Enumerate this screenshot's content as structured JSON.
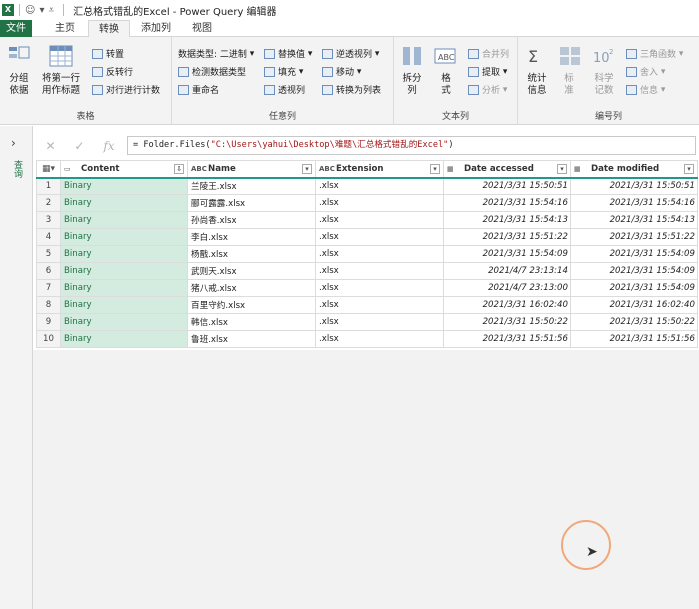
{
  "titlebar": {
    "app_icon": "X",
    "title": "汇总格式错乱的Excel - Power Query 编辑器"
  },
  "tabs": [
    {
      "label": "文件"
    },
    {
      "label": "主页"
    },
    {
      "label": "转换"
    },
    {
      "label": "添加列"
    },
    {
      "label": "视图"
    }
  ],
  "ribbon": {
    "table_group": {
      "label": "表格",
      "group_by": "分组\n依据",
      "first_row_header": "将第一行\n用作标题",
      "transpose": "转置",
      "reverse_rows": "反转行",
      "count_rows": "对行进行计数"
    },
    "any_column_group": {
      "label": "任意列",
      "data_type": "数据类型: 二进制",
      "detect_type": "检测数据类型",
      "rename": "重命名",
      "replace_values": "替换值",
      "fill": "填充",
      "pivot": "透视列",
      "unpivot": "逆透视列",
      "move": "移动",
      "to_list": "转换为列表"
    },
    "text_group": {
      "label": "文本列",
      "split": "拆分\n列",
      "format": "格\n式",
      "merge": "合并列",
      "extract": "提取",
      "parse": "分析"
    },
    "number_group": {
      "label": "编号列",
      "statistics": "统计\n信息",
      "standard": "标\n准",
      "scientific": "科学\n记数",
      "trig": "三角函数",
      "rounding": "舍入",
      "info": "信息"
    }
  },
  "left_pane": {
    "label": "查询"
  },
  "formula_bar": {
    "prefix": "= Folder.Files(",
    "string": "\"C:\\Users\\yahui\\Desktop\\难题\\汇总格式错乱的Excel\"",
    "suffix": ")"
  },
  "table": {
    "columns": [
      {
        "name": "Content",
        "type_icon": "▭"
      },
      {
        "name": "Name",
        "type_icon": "ABC"
      },
      {
        "name": "Extension",
        "type_icon": "ABC"
      },
      {
        "name": "Date accessed",
        "type_icon": "▦"
      },
      {
        "name": "Date modified",
        "type_icon": "▦"
      }
    ],
    "rows": [
      {
        "n": "1",
        "content": "Binary",
        "name": "兰陵王.xlsx",
        "ext": ".xlsx",
        "accessed": "2021/3/31 15:50:51",
        "modified": "2021/3/31 15:50:51"
      },
      {
        "n": "2",
        "content": "Binary",
        "name": "郦可露露.xlsx",
        "ext": ".xlsx",
        "accessed": "2021/3/31 15:54:16",
        "modified": "2021/3/31 15:54:16"
      },
      {
        "n": "3",
        "content": "Binary",
        "name": "孙尚香.xlsx",
        "ext": ".xlsx",
        "accessed": "2021/3/31 15:54:13",
        "modified": "2021/3/31 15:54:13"
      },
      {
        "n": "4",
        "content": "Binary",
        "name": "李白.xlsx",
        "ext": ".xlsx",
        "accessed": "2021/3/31 15:51:22",
        "modified": "2021/3/31 15:51:22"
      },
      {
        "n": "5",
        "content": "Binary",
        "name": "杨戬.xlsx",
        "ext": ".xlsx",
        "accessed": "2021/3/31 15:54:09",
        "modified": "2021/3/31 15:54:09"
      },
      {
        "n": "6",
        "content": "Binary",
        "name": "武则天.xlsx",
        "ext": ".xlsx",
        "accessed": "2021/4/7 23:13:14",
        "modified": "2021/3/31 15:54:09"
      },
      {
        "n": "7",
        "content": "Binary",
        "name": "猪八戒.xlsx",
        "ext": ".xlsx",
        "accessed": "2021/4/7 23:13:00",
        "modified": "2021/3/31 15:54:09"
      },
      {
        "n": "8",
        "content": "Binary",
        "name": "百里守约.xlsx",
        "ext": ".xlsx",
        "accessed": "2021/3/31 16:02:40",
        "modified": "2021/3/31 16:02:40"
      },
      {
        "n": "9",
        "content": "Binary",
        "name": "韩信.xlsx",
        "ext": ".xlsx",
        "accessed": "2021/3/31 15:50:22",
        "modified": "2021/3/31 15:50:22"
      },
      {
        "n": "10",
        "content": "Binary",
        "name": "鲁班.xlsx",
        "ext": ".xlsx",
        "accessed": "2021/3/31 15:51:56",
        "modified": "2021/3/31 15:51:56"
      }
    ]
  }
}
